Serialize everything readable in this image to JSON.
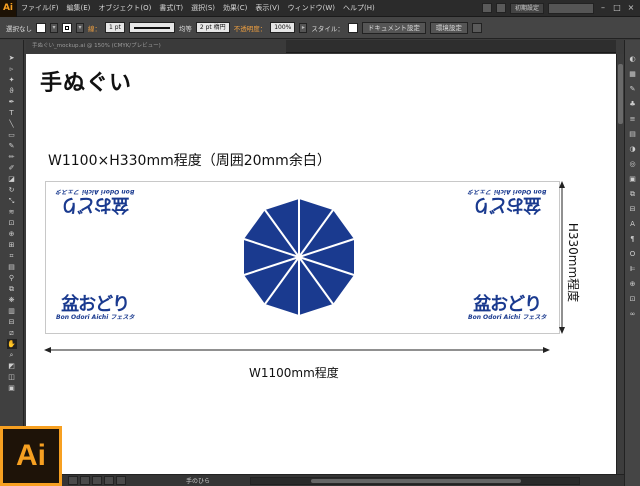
{
  "app": {
    "logo_small": "Ai",
    "logo_big": "Ai"
  },
  "menu": {
    "items": [
      "ファイル(F)",
      "編集(E)",
      "オブジェクト(O)",
      "書式(T)",
      "選択(S)",
      "効果(C)",
      "表示(V)",
      "ウィンドウ(W)",
      "ヘルプ(H)"
    ],
    "workspace": "初期設定"
  },
  "control": {
    "selection": "選択なし",
    "stroke_label": "線：",
    "stroke_weight": "1 pt",
    "profile_label": "均等",
    "brush": "2 pt 楕円",
    "opacity_label": "不透明度：",
    "opacity_value": "100%",
    "style_label": "スタイル：",
    "doc_setup": "ドキュメント設定",
    "prefs": "環境設定"
  },
  "document": {
    "tab_label": "手ぬぐい_mockup.ai @ 150% (CMYK/プレビュー)"
  },
  "artwork": {
    "title": "手ぬぐい",
    "spec": "W1100×H330mm程度（周囲20mm余白）",
    "logo_main": "盆おどり",
    "logo_sub": "Bon Odori Aichi フェスタ",
    "width_label": "W1100mm程度",
    "height_label": "H330mm程度",
    "brand_color": "#1a3a8f"
  },
  "status": {
    "zoom": "",
    "tool": "手のひら"
  }
}
